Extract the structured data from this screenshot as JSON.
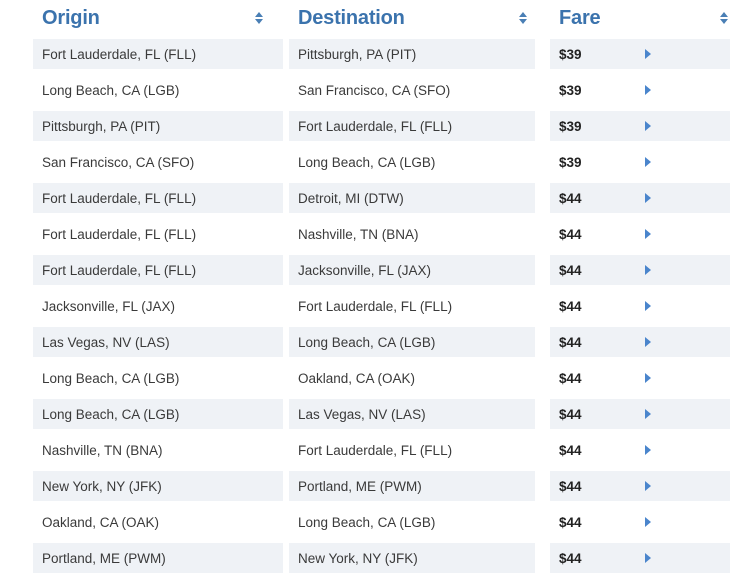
{
  "table": {
    "columns": [
      {
        "key": "origin",
        "label": "Origin",
        "sort_icon": "sort-updown-icon",
        "sortable": true
      },
      {
        "key": "destination",
        "label": "Destination",
        "sort_icon": "sort-updown-icon",
        "sortable": true
      },
      {
        "key": "fare",
        "label": "Fare",
        "sort_icon": "sort-updown-icon",
        "sortable": true
      }
    ],
    "row_detail_icon": "chevron-right-icon",
    "accent_color": "#3b73ad",
    "arrow_color": "#4a85cc",
    "shaded_row_color": "#eff2f6",
    "rows": [
      {
        "origin": "Fort Lauderdale, FL (FLL)",
        "destination": "Pittsburgh, PA (PIT)",
        "fare": "$39"
      },
      {
        "origin": "Long Beach, CA (LGB)",
        "destination": "San Francisco, CA (SFO)",
        "fare": "$39"
      },
      {
        "origin": "Pittsburgh, PA (PIT)",
        "destination": "Fort Lauderdale, FL (FLL)",
        "fare": "$39"
      },
      {
        "origin": "San Francisco, CA (SFO)",
        "destination": "Long Beach, CA (LGB)",
        "fare": "$39"
      },
      {
        "origin": "Fort Lauderdale, FL (FLL)",
        "destination": "Detroit, MI (DTW)",
        "fare": "$44"
      },
      {
        "origin": "Fort Lauderdale, FL (FLL)",
        "destination": "Nashville, TN (BNA)",
        "fare": "$44"
      },
      {
        "origin": "Fort Lauderdale, FL (FLL)",
        "destination": "Jacksonville, FL (JAX)",
        "fare": "$44"
      },
      {
        "origin": "Jacksonville, FL (JAX)",
        "destination": "Fort Lauderdale, FL (FLL)",
        "fare": "$44"
      },
      {
        "origin": "Las Vegas, NV (LAS)",
        "destination": "Long Beach, CA (LGB)",
        "fare": "$44"
      },
      {
        "origin": "Long Beach, CA (LGB)",
        "destination": "Oakland, CA (OAK)",
        "fare": "$44"
      },
      {
        "origin": "Long Beach, CA (LGB)",
        "destination": "Las Vegas, NV (LAS)",
        "fare": "$44"
      },
      {
        "origin": "Nashville, TN (BNA)",
        "destination": "Fort Lauderdale, FL (FLL)",
        "fare": "$44"
      },
      {
        "origin": "New York, NY (JFK)",
        "destination": "Portland, ME (PWM)",
        "fare": "$44"
      },
      {
        "origin": "Oakland, CA (OAK)",
        "destination": "Long Beach, CA (LGB)",
        "fare": "$44"
      },
      {
        "origin": "Portland, ME (PWM)",
        "destination": "New York, NY (JFK)",
        "fare": "$44"
      }
    ]
  }
}
